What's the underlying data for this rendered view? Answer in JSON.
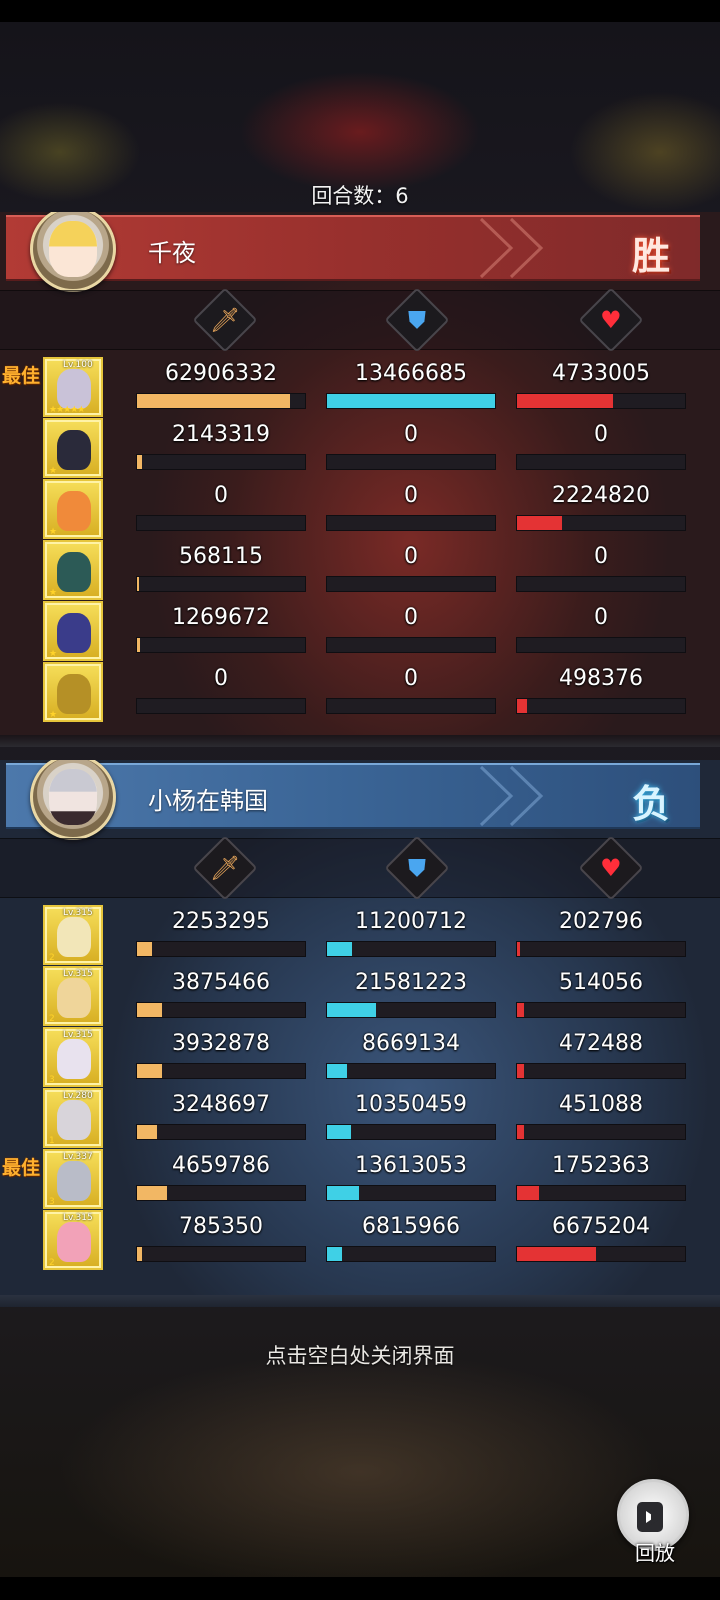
{
  "round": {
    "label": "回合数：6"
  },
  "teams": [
    {
      "player_name": "千夜",
      "result": "胜",
      "color": "#a8352f",
      "rows": [
        {
          "level": "Lv.100",
          "stars": "★★★★★",
          "best": "最佳",
          "damage": "62906332",
          "damage_pct": 91,
          "defense": "13466685",
          "defense_pct": 100,
          "heal": "4733005",
          "heal_pct": 57,
          "hero_color": "#c9c2d8"
        },
        {
          "level": "",
          "stars": "★",
          "best": "",
          "damage": "2143319",
          "damage_pct": 3,
          "defense": "0",
          "defense_pct": 0,
          "heal": "0",
          "heal_pct": 0,
          "hero_color": "#2a2a3a"
        },
        {
          "level": "",
          "stars": "★",
          "best": "",
          "damage": "0",
          "damage_pct": 0,
          "defense": "0",
          "defense_pct": 0,
          "heal": "2224820",
          "heal_pct": 27,
          "hero_color": "#f08a3a"
        },
        {
          "level": "",
          "stars": "★",
          "best": "",
          "damage": "568115",
          "damage_pct": 1,
          "defense": "0",
          "defense_pct": 0,
          "heal": "0",
          "heal_pct": 0,
          "hero_color": "#2c5a56"
        },
        {
          "level": "",
          "stars": "★",
          "best": "",
          "damage": "1269672",
          "damage_pct": 2,
          "defense": "0",
          "defense_pct": 0,
          "heal": "0",
          "heal_pct": 0,
          "hero_color": "#3a3c8a"
        },
        {
          "level": "",
          "stars": "★",
          "best": "",
          "damage": "0",
          "damage_pct": 0,
          "defense": "0",
          "defense_pct": 0,
          "heal": "498376",
          "heal_pct": 6,
          "hero_color": "#b59026"
        }
      ]
    },
    {
      "player_name": "小杨在韩国",
      "result": "负",
      "color": "#3f6b9e",
      "rows": [
        {
          "level": "Lv.315",
          "stars": "2",
          "best": "",
          "damage": "2253295",
          "damage_pct": 9,
          "defense": "11200712",
          "defense_pct": 15,
          "heal": "202796",
          "heal_pct": 2,
          "hero_color": "#f2e6b8"
        },
        {
          "level": "Lv.315",
          "stars": "2",
          "best": "",
          "damage": "3875466",
          "damage_pct": 15,
          "defense": "21581223",
          "defense_pct": 29,
          "heal": "514056",
          "heal_pct": 4,
          "hero_color": "#efd59a"
        },
        {
          "level": "Lv.315",
          "stars": "3",
          "best": "",
          "damage": "3932878",
          "damage_pct": 15,
          "defense": "8669134",
          "defense_pct": 12,
          "heal": "472488",
          "heal_pct": 4,
          "hero_color": "#e8e2ee"
        },
        {
          "level": "Lv.280",
          "stars": "1",
          "best": "",
          "damage": "3248697",
          "damage_pct": 12,
          "defense": "10350459",
          "defense_pct": 14,
          "heal": "451088",
          "heal_pct": 4,
          "hero_color": "#d8d4da"
        },
        {
          "level": "Lv.337",
          "stars": "3",
          "best": "最佳",
          "damage": "4659786",
          "damage_pct": 18,
          "defense": "13613053",
          "defense_pct": 19,
          "heal": "1752363",
          "heal_pct": 13,
          "hero_color": "#b9bcc8"
        },
        {
          "level": "Lv.315",
          "stars": "2",
          "best": "",
          "damage": "785350",
          "damage_pct": 3,
          "defense": "6815966",
          "defense_pct": 9,
          "heal": "6675204",
          "heal_pct": 47,
          "hero_color": "#f2a2b8"
        }
      ]
    }
  ],
  "icons": {
    "damage": "sword-icon",
    "defense": "shield-icon",
    "heal": "heart-icon",
    "replay": "video-camera-icon"
  },
  "hint": "点击空白处关闭界面",
  "replay_label": "回放"
}
